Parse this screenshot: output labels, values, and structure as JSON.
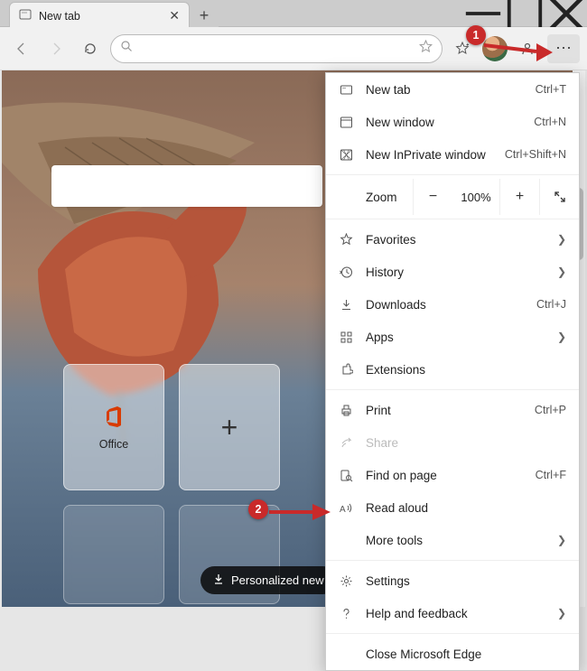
{
  "tab": {
    "title": "New tab"
  },
  "toolbar": {},
  "tiles": {
    "office": "Office"
  },
  "pill": {
    "text": "Personalized new"
  },
  "menu": {
    "new_tab": "New tab",
    "new_tab_cut": "Ctrl+T",
    "new_window": "New window",
    "new_window_cut": "Ctrl+N",
    "inprivate": "New InPrivate window",
    "inprivate_cut": "Ctrl+Shift+N",
    "zoom_label": "Zoom",
    "zoom_value": "100%",
    "favorites": "Favorites",
    "history": "History",
    "downloads": "Downloads",
    "downloads_cut": "Ctrl+J",
    "apps": "Apps",
    "extensions": "Extensions",
    "print": "Print",
    "print_cut": "Ctrl+P",
    "share": "Share",
    "find": "Find on page",
    "find_cut": "Ctrl+F",
    "read_aloud": "Read aloud",
    "more_tools": "More tools",
    "settings": "Settings",
    "help": "Help and feedback",
    "close": "Close Microsoft Edge"
  },
  "badges": {
    "one": "1",
    "two": "2"
  }
}
